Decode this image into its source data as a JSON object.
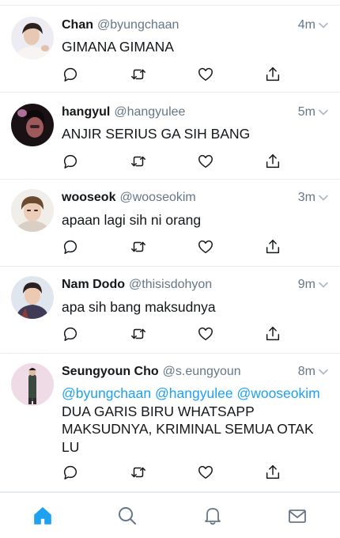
{
  "tweets": [
    {
      "name": "Chan",
      "handle": "@byungchaan",
      "time": "4m",
      "text": "GIMANA GIMANA",
      "avatar_icon": "user-avatar-photo"
    },
    {
      "name": "hangyul",
      "handle": "@hangyulee",
      "time": "5m",
      "text": "ANJIR SERIUS GA SIH BANG",
      "avatar_icon": "user-avatar-photo"
    },
    {
      "name": "wooseok",
      "handle": "@wooseokim",
      "time": "3m",
      "text": "apaan lagi sih ni orang",
      "avatar_icon": "user-avatar-photo"
    },
    {
      "name": "Nam Dodo",
      "handle": "@thisisdohyon",
      "time": "9m",
      "text": "apa sih bang maksudnya",
      "avatar_icon": "user-avatar-photo"
    },
    {
      "name": "Seungyoun Cho",
      "handle": "@s.eungyoun",
      "time": "8m",
      "mentions": [
        "@byungchaan",
        "@hangyulee",
        "@wooseokim"
      ],
      "text_after_mentions": "DUA GARIS BIRU WHATSAPP MAKSUDNYA, KRIMINAL SEMUA OTAK LU",
      "avatar_icon": "user-avatar-photo"
    }
  ],
  "action_icons": [
    "reply-icon",
    "retweet-icon",
    "like-icon",
    "share-icon"
  ],
  "tabbar": {
    "items": [
      "home-icon",
      "search-icon",
      "notifications-icon",
      "messages-icon"
    ],
    "active": "home-icon"
  },
  "colors": {
    "accent": "#1da1f2",
    "text": "#14171a",
    "secondary": "#657786",
    "divider": "#e6ecf0"
  }
}
